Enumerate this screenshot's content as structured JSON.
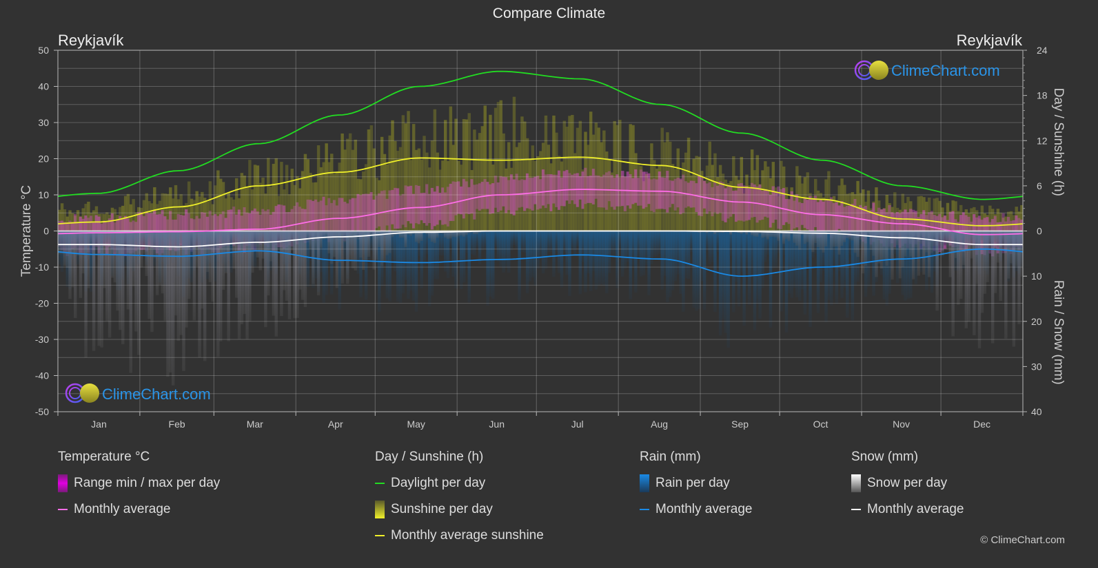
{
  "page": {
    "title": "Compare Climate",
    "city_left": "Reykjavík",
    "city_right": "Reykjavík",
    "logo_text": "ClimeChart.com",
    "copyright": "© ClimeChart.com"
  },
  "legend": {
    "groups": [
      {
        "title": "Temperature °C",
        "items": [
          {
            "label": "Range min / max per day",
            "swatch": "bar",
            "color": "#e000e0"
          },
          {
            "label": "Monthly average",
            "swatch": "line",
            "color": "#ff6ee8"
          }
        ]
      },
      {
        "title": "Day / Sunshine (h)",
        "items": [
          {
            "label": "Daylight per day",
            "swatch": "line",
            "color": "#22dd22"
          },
          {
            "label": "Sunshine per day",
            "swatch": "bar",
            "color": "#e6e62a"
          },
          {
            "label": "Monthly average sunshine",
            "swatch": "line",
            "color": "#f0f02a"
          }
        ]
      },
      {
        "title": "Rain (mm)",
        "items": [
          {
            "label": "Rain per day",
            "swatch": "bar",
            "color": "#1a8ae6"
          },
          {
            "label": "Monthly average",
            "swatch": "line",
            "color": "#1a8ae6"
          }
        ]
      },
      {
        "title": "Snow (mm)",
        "items": [
          {
            "label": "Snow per day",
            "swatch": "bar",
            "color": "#dddddd"
          },
          {
            "label": "Monthly average",
            "swatch": "line",
            "color": "#ffffff"
          }
        ]
      }
    ]
  },
  "chart_data": {
    "type": "line",
    "title": "Compare Climate",
    "categories": [
      "Jan",
      "Feb",
      "Mar",
      "Apr",
      "May",
      "Jun",
      "Jul",
      "Aug",
      "Sep",
      "Oct",
      "Nov",
      "Dec"
    ],
    "axes": {
      "left": {
        "label": "Temperature °C",
        "range": [
          -50,
          50
        ],
        "ticks": [
          50,
          40,
          30,
          20,
          10,
          0,
          -10,
          -20,
          -30,
          -40,
          -50
        ]
      },
      "right_top": {
        "label": "Day / Sunshine (h)",
        "range": [
          0,
          24
        ],
        "ticks": [
          24,
          18,
          12,
          6,
          0
        ]
      },
      "right_bottom": {
        "label": "Rain / Snow (mm)",
        "range": [
          0,
          40
        ],
        "ticks": [
          0,
          10,
          20,
          30,
          40
        ]
      }
    },
    "grid": true,
    "series": [
      {
        "name": "Daylight per day",
        "axis": "hours",
        "color": "#22dd22",
        "values": [
          5.0,
          8.0,
          11.6,
          15.4,
          19.2,
          21.2,
          20.2,
          16.8,
          13.0,
          9.4,
          6.0,
          4.2
        ]
      },
      {
        "name": "Monthly average sunshine",
        "axis": "hours",
        "color": "#f0f02a",
        "values": [
          1.2,
          3.2,
          6.0,
          7.8,
          9.7,
          9.4,
          9.8,
          8.7,
          5.8,
          4.2,
          1.6,
          0.7
        ]
      },
      {
        "name": "Temperature monthly average",
        "axis": "temp",
        "color": "#ff6ee8",
        "values": [
          -0.5,
          -0.2,
          0.5,
          3.5,
          6.5,
          10.0,
          11.5,
          11.0,
          8.0,
          4.5,
          2.0,
          -1.0
        ]
      },
      {
        "name": "Snow monthly average",
        "axis": "precip",
        "color": "#ffffff",
        "values": [
          3.0,
          3.5,
          2.5,
          1.3,
          0.3,
          0.0,
          0.0,
          0.0,
          0.1,
          0.5,
          1.5,
          3.0
        ]
      },
      {
        "name": "Rain monthly average",
        "axis": "precip",
        "color": "#1a8ae6",
        "values": [
          5.2,
          5.6,
          4.4,
          6.5,
          7.0,
          6.3,
          5.3,
          6.2,
          10.0,
          8.0,
          6.2,
          4.0
        ]
      }
    ],
    "temp_range_daily": {
      "min": [
        -4,
        -4,
        -3,
        0,
        3,
        7,
        9,
        8,
        5,
        1,
        -2,
        -4
      ],
      "max": [
        2,
        3,
        4,
        7,
        10,
        13,
        15,
        14,
        11,
        7,
        4,
        2
      ]
    },
    "legend_position": "bottom"
  }
}
